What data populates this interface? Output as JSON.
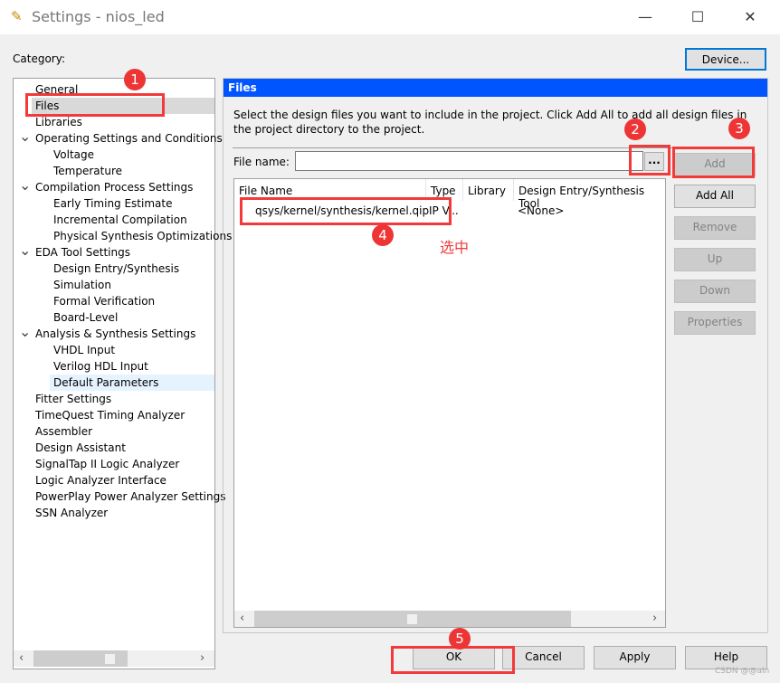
{
  "window": {
    "title": "Settings - nios_led",
    "minimize": "—",
    "maximize": "☐",
    "close": "✕"
  },
  "category_label": "Category:",
  "device_button": "Device...",
  "tree": [
    {
      "label": "General",
      "level": 0
    },
    {
      "label": "Files",
      "level": 0,
      "selected": true
    },
    {
      "label": "Libraries",
      "level": 0
    },
    {
      "label": "Operating Settings and Conditions",
      "level": 0,
      "expanded": true
    },
    {
      "label": "Voltage",
      "level": 1
    },
    {
      "label": "Temperature",
      "level": 1
    },
    {
      "label": "Compilation Process Settings",
      "level": 0,
      "expanded": true
    },
    {
      "label": "Early Timing Estimate",
      "level": 1
    },
    {
      "label": "Incremental Compilation",
      "level": 1
    },
    {
      "label": "Physical Synthesis Optimizations",
      "level": 1
    },
    {
      "label": "EDA Tool Settings",
      "level": 0,
      "expanded": true
    },
    {
      "label": "Design Entry/Synthesis",
      "level": 1
    },
    {
      "label": "Simulation",
      "level": 1
    },
    {
      "label": "Formal Verification",
      "level": 1
    },
    {
      "label": "Board-Level",
      "level": 1
    },
    {
      "label": "Analysis & Synthesis Settings",
      "level": 0,
      "expanded": true
    },
    {
      "label": "VHDL Input",
      "level": 1
    },
    {
      "label": "Verilog HDL Input",
      "level": 1
    },
    {
      "label": "Default Parameters",
      "level": 1,
      "hover": true
    },
    {
      "label": "Fitter Settings",
      "level": 0
    },
    {
      "label": "TimeQuest Timing Analyzer",
      "level": 0
    },
    {
      "label": "Assembler",
      "level": 0
    },
    {
      "label": "Design Assistant",
      "level": 0
    },
    {
      "label": "SignalTap II Logic Analyzer",
      "level": 0
    },
    {
      "label": "Logic Analyzer Interface",
      "level": 0
    },
    {
      "label": "PowerPlay Power Analyzer Settings",
      "level": 0
    },
    {
      "label": "SSN Analyzer",
      "level": 0
    }
  ],
  "panel": {
    "header": "Files",
    "header_color": "#0055ff",
    "description": "Select the design files you want to include in the project. Click Add All to add all design files in the project directory to the project.",
    "file_name_label": "File name:",
    "file_name_value": "",
    "browse_label": "...",
    "columns": [
      "File Name",
      "Type",
      "Library",
      "Design Entry/Synthesis Tool"
    ],
    "rows": [
      {
        "file": "qsys/kernel/synthesis/kernel.qip",
        "type": "IP V...",
        "library": "",
        "tool": "<None>"
      }
    ],
    "buttons": {
      "add": "Add",
      "add_all": "Add All",
      "remove": "Remove",
      "up": "Up",
      "down": "Down",
      "properties": "Properties"
    }
  },
  "annotations": {
    "b1": "1",
    "b2": "2",
    "b3": "3",
    "b4": "4",
    "b5": "5",
    "note": "选中",
    "color": "#f23a3a"
  },
  "footer": {
    "ok": "OK",
    "cancel": "Cancel",
    "apply": "Apply",
    "help": "Help"
  },
  "watermark": "CSDN @@aln"
}
